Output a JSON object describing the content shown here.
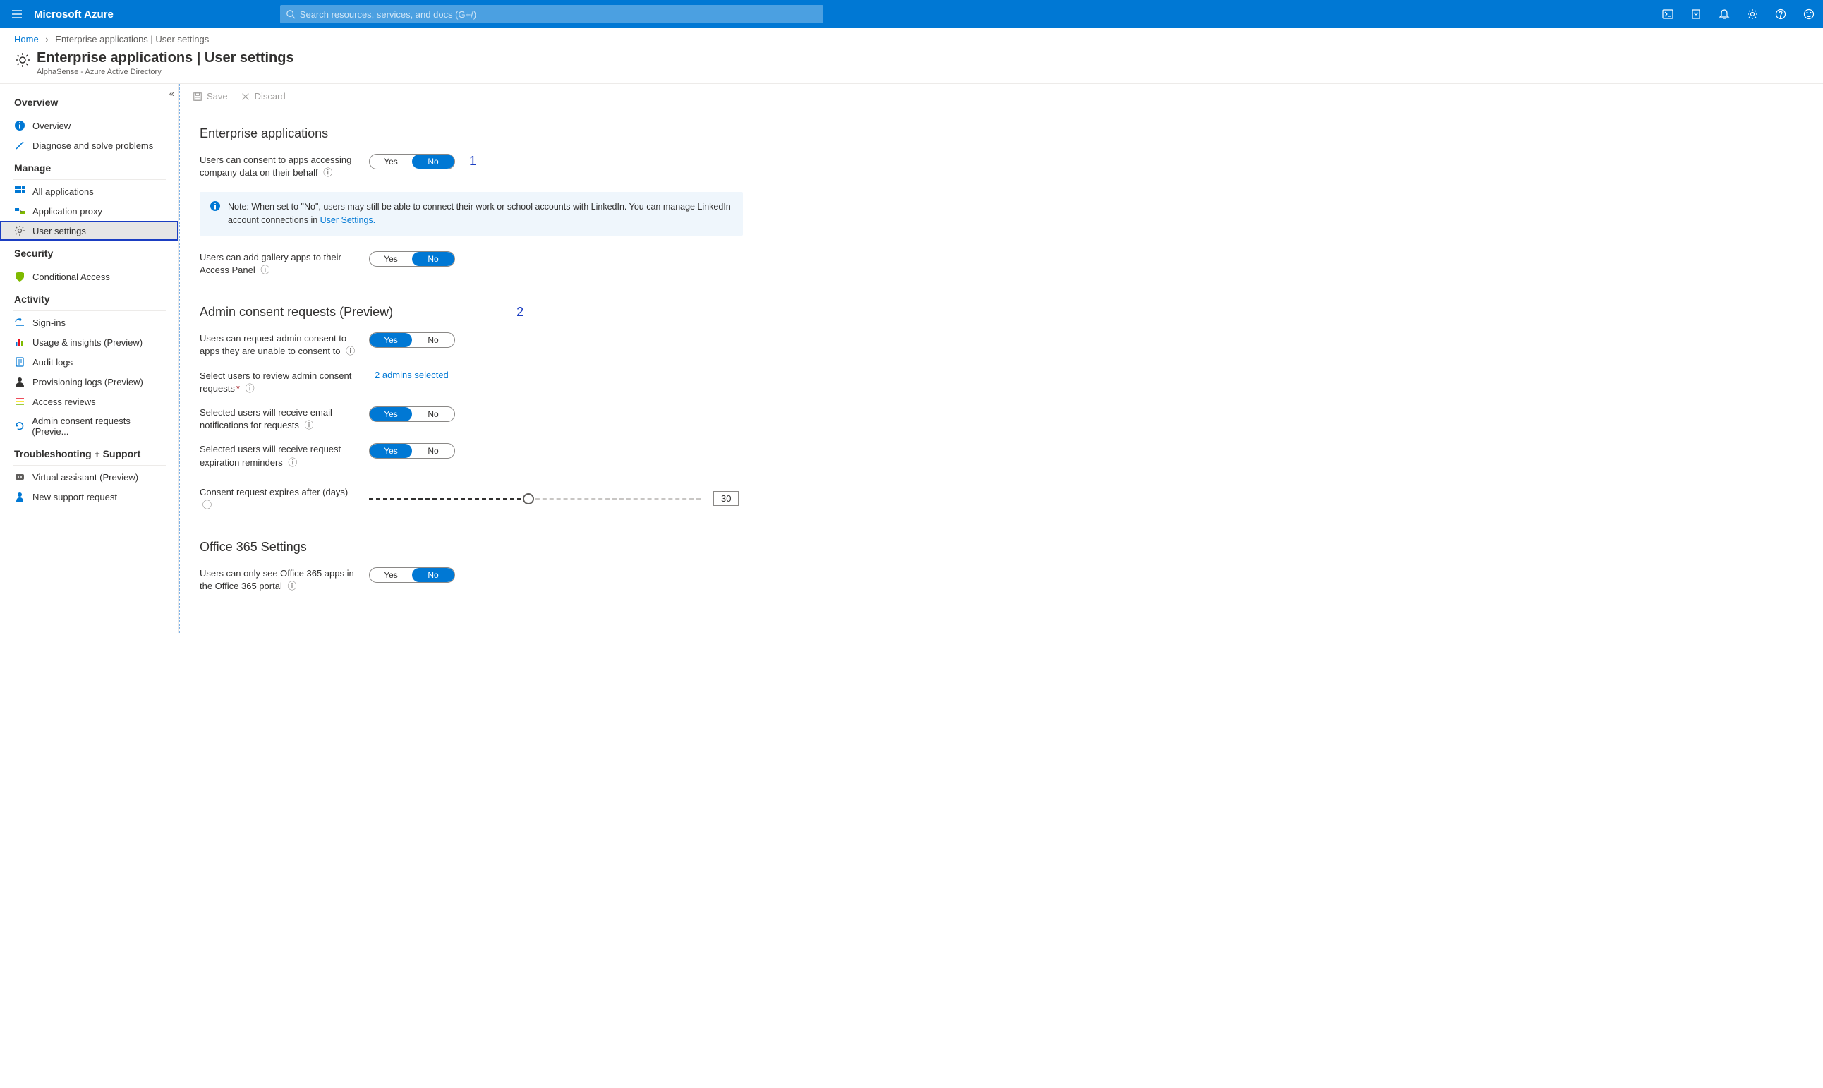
{
  "topbar": {
    "brand": "Microsoft Azure",
    "search_placeholder": "Search resources, services, and docs (G+/)"
  },
  "breadcrumb": {
    "home": "Home",
    "current": "Enterprise applications | User settings"
  },
  "header": {
    "title": "Enterprise applications | User settings",
    "subtitle": "AlphaSense - Azure Active Directory"
  },
  "toolbar": {
    "save": "Save",
    "discard": "Discard"
  },
  "sidebar": {
    "section_overview": "Overview",
    "item_overview": "Overview",
    "item_diagnose": "Diagnose and solve problems",
    "section_manage": "Manage",
    "item_all_apps": "All applications",
    "item_app_proxy": "Application proxy",
    "item_user_settings": "User settings",
    "section_security": "Security",
    "item_conditional": "Conditional Access",
    "section_activity": "Activity",
    "item_signins": "Sign-ins",
    "item_usage": "Usage & insights (Preview)",
    "item_audit": "Audit logs",
    "item_prov_logs": "Provisioning logs (Preview)",
    "item_access_reviews": "Access reviews",
    "item_admin_consent": "Admin consent requests (Previe...",
    "section_trouble": "Troubleshooting + Support",
    "item_virtual_assist": "Virtual assistant (Preview)",
    "item_support_req": "New support request"
  },
  "sections": {
    "enterprise": "Enterprise applications",
    "admin": "Admin consent requests (Preview)",
    "office": "Office 365 Settings"
  },
  "labels": {
    "yes": "Yes",
    "no": "No",
    "field1": "Users can consent to apps accessing company data on their behalf",
    "field2": "Users can add gallery apps to their Access Panel",
    "field3": "Users can request admin consent to apps they are unable to consent to",
    "field4": "Select users to review admin consent requests",
    "field4_value": "2 admins selected",
    "field5": "Selected users will receive email notifications for requests",
    "field6": "Selected users will receive request expiration reminders",
    "field7": "Consent request expires after (days)",
    "slider_value": "30",
    "field8": "Users can only see Office 365 apps in the Office 365 portal"
  },
  "infobox": {
    "text_a": "Note: When set to \"No\", users may still be able to connect their work or school accounts with LinkedIn. You can manage LinkedIn account connections in ",
    "link": "User Settings."
  },
  "annotations": {
    "a1": "1",
    "a2": "2"
  }
}
